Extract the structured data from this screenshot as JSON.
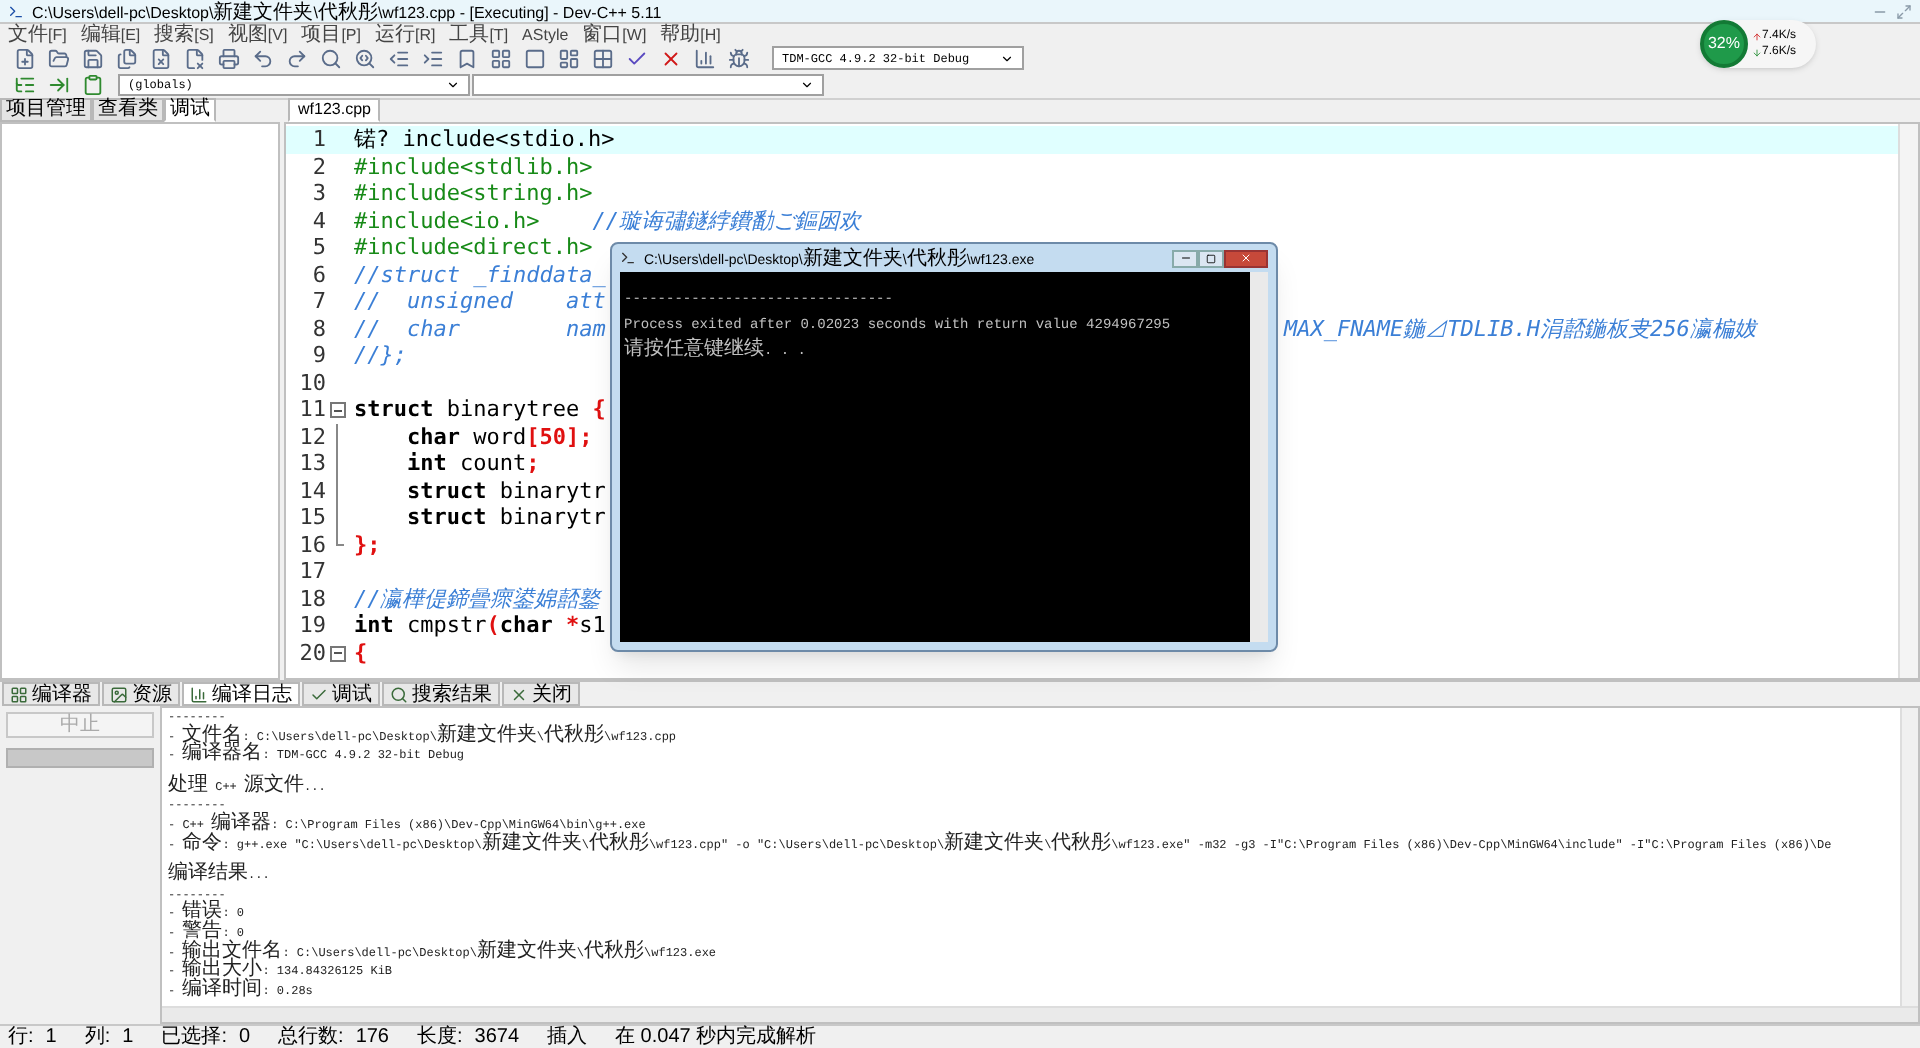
{
  "window": {
    "title": "C:\\Users\\dell-pc\\Desktop\\新建文件夹\\代秋彤\\wf123.cpp - [Executing] - Dev-C++ 5.11"
  },
  "menu": [
    "文件[F]",
    "编辑[E]",
    "搜索[S]",
    "视图[V]",
    "项目[P]",
    "运行[R]",
    "工具[T]",
    "AStyle",
    "窗口[W]",
    "帮助[H]"
  ],
  "compiler_select": {
    "value": "TDM-GCC 4.9.2 32-bit Debug"
  },
  "scope_select": {
    "value": "(globals)"
  },
  "speed_widget": {
    "percent": "32%",
    "upload": "7.4K/s",
    "download": "7.6K/s"
  },
  "side_tabs": [
    {
      "label": "项目管理",
      "selected": false
    },
    {
      "label": "查看类",
      "selected": false
    },
    {
      "label": "调试",
      "selected": true
    }
  ],
  "editor_tabs": [
    {
      "label": "wf123.cpp",
      "selected": true
    }
  ],
  "code_lines": [
    {
      "number": "1",
      "kind": "plain",
      "current": true,
      "segments": [
        {
          "kind": "plain",
          "text": "锘? include<stdio.h>"
        }
      ]
    },
    {
      "number": "2",
      "kind": "plain",
      "current": false,
      "segments": [
        {
          "kind": "preproc",
          "text": "#include<stdlib.h>"
        }
      ]
    },
    {
      "number": "3",
      "kind": "plain",
      "current": false,
      "segments": [
        {
          "kind": "preproc",
          "text": "#include<string.h>"
        }
      ]
    },
    {
      "number": "4",
      "kind": "plain",
      "current": false,
      "segments": [
        {
          "kind": "preproc",
          "text": "#include<io.h>    "
        },
        {
          "kind": "comment",
          "text": "//璇诲彇鐩綍鐨勫ご鏂囦欢"
        }
      ]
    },
    {
      "number": "5",
      "kind": "plain",
      "current": false,
      "segments": [
        {
          "kind": "preproc",
          "text": "#include<direct.h>"
        }
      ]
    },
    {
      "number": "6",
      "kind": "plain",
      "current": false,
      "segments": [
        {
          "kind": "comment",
          "text": "//struct _finddata_"
        }
      ]
    },
    {
      "number": "7",
      "kind": "plain",
      "current": false,
      "segments": [
        {
          "kind": "comment",
          "text": "//  unsigned    att"
        }
      ]
    },
    {
      "number": "8",
      "kind": "plain",
      "current": false,
      "segments": [
        {
          "kind": "comment",
          "text": "//  char        nam"
        }
      ],
      "tail": "MAX_FNAME鍦⊿TDLIB.H涓嚭鍦板叏256瀛楄妭"
    },
    {
      "number": "9",
      "kind": "plain",
      "current": false,
      "segments": [
        {
          "kind": "comment",
          "text": "//};"
        }
      ]
    },
    {
      "number": "10",
      "kind": "plain",
      "current": false
    },
    {
      "number": "11",
      "kind": "fold_start",
      "current": false,
      "segments": [
        {
          "kind": "keyword",
          "text": "struct"
        },
        {
          "kind": "plain",
          "text": " binarytree "
        },
        {
          "kind": "punct",
          "text": "{"
        }
      ]
    },
    {
      "number": "12",
      "kind": "fold_body",
      "current": false,
      "segments": [
        {
          "kind": "keyword",
          "text": "    char"
        },
        {
          "kind": "plain",
          "text": " word"
        },
        {
          "kind": "punct",
          "text": "[50];"
        }
      ]
    },
    {
      "number": "13",
      "kind": "fold_body",
      "current": false,
      "segments": [
        {
          "kind": "keyword",
          "text": "    int"
        },
        {
          "kind": "plain",
          "text": " count"
        },
        {
          "kind": "punct",
          "text": ";"
        }
      ]
    },
    {
      "number": "14",
      "kind": "fold_body",
      "current": false,
      "segments": [
        {
          "kind": "keyword",
          "text": "    struct"
        },
        {
          "kind": "plain",
          "text": " binarytr"
        }
      ]
    },
    {
      "number": "15",
      "kind": "fold_body",
      "current": false,
      "segments": [
        {
          "kind": "keyword",
          "text": "    struct"
        },
        {
          "kind": "plain",
          "text": " binarytr"
        }
      ]
    },
    {
      "number": "16",
      "kind": "fold_end",
      "current": false,
      "segments": [
        {
          "kind": "punct",
          "text": "};"
        }
      ]
    },
    {
      "number": "17",
      "kind": "plain",
      "current": false
    },
    {
      "number": "18",
      "kind": "plain",
      "current": false,
      "segments": [
        {
          "kind": "comment",
          "text": "//瀛樺偍鍗曡瘝鍙婂嚭鐜"
        }
      ]
    },
    {
      "number": "19",
      "kind": "plain",
      "current": false,
      "segments": [
        {
          "kind": "keyword",
          "text": "int"
        },
        {
          "kind": "plain",
          "text": " cmpstr"
        },
        {
          "kind": "punct",
          "text": "("
        },
        {
          "kind": "keyword",
          "text": "char"
        },
        {
          "kind": "punct",
          "text": " *"
        },
        {
          "kind": "plain",
          "text": "s1"
        }
      ]
    },
    {
      "number": "20",
      "kind": "fold_start",
      "current": false,
      "segments": [
        {
          "kind": "punct",
          "text": "{"
        }
      ]
    }
  ],
  "console": {
    "title": "C:\\Users\\dell-pc\\Desktop\\新建文件夹\\代秋彤\\wf123.exe",
    "lines": [
      "--------------------------------",
      "Process exited after 0.02023 seconds with return value 4294967295",
      "请按任意键继续. . ."
    ]
  },
  "bottom_tabs": [
    {
      "label": "编译器",
      "selected": false
    },
    {
      "label": "资源",
      "selected": false
    },
    {
      "label": "编译日志",
      "selected": true
    },
    {
      "label": "调试",
      "selected": false
    },
    {
      "label": "搜索结果",
      "selected": false
    },
    {
      "label": "关闭",
      "selected": false
    }
  ],
  "abort_button": {
    "label": "中止",
    "disabled": true
  },
  "log_blocks": [
    {
      "lines": [
        "--------",
        "- 文件名: C:\\Users\\dell-pc\\Desktop\\新建文件夹\\代秋彤\\wf123.cpp",
        "- 编译器名: TDM-GCC 4.9.2 32-bit Debug"
      ]
    },
    {
      "lines": [
        "处理 C++ 源文件...",
        "--------",
        "- C++ 编译器: C:\\Program Files (x86)\\Dev-Cpp\\MinGW64\\bin\\g++.exe",
        "- 命令: g++.exe \"C:\\Users\\dell-pc\\Desktop\\新建文件夹\\代秋彤\\wf123.cpp\" -o \"C:\\Users\\dell-pc\\Desktop\\新建文件夹\\代秋彤\\wf123.exe\" -m32 -g3 -I\"C:\\Program Files (x86)\\Dev-Cpp\\MinGW64\\include\" -I\"C:\\Program Files (x86)\\De"
      ]
    },
    {
      "lines": [
        "编译结果...",
        "--------",
        "- 错误: 0",
        "- 警告: 0",
        "- 输出文件名: C:\\Users\\dell-pc\\Desktop\\新建文件夹\\代秋彤\\wf123.exe",
        "- 输出大小: 134.84326125 KiB",
        "- 编译时间: 0.28s"
      ]
    }
  ],
  "status_bar": [
    {
      "label": "行:",
      "value": "1"
    },
    {
      "label": "列:",
      "value": "1"
    },
    {
      "label": "已选择:",
      "value": "0"
    },
    {
      "label": "总行数:",
      "value": "176"
    },
    {
      "label": "长度:",
      "value": "3674"
    },
    {
      "label": "插入"
    },
    {
      "label": "在 0.047 秒内完成解析"
    }
  ]
}
